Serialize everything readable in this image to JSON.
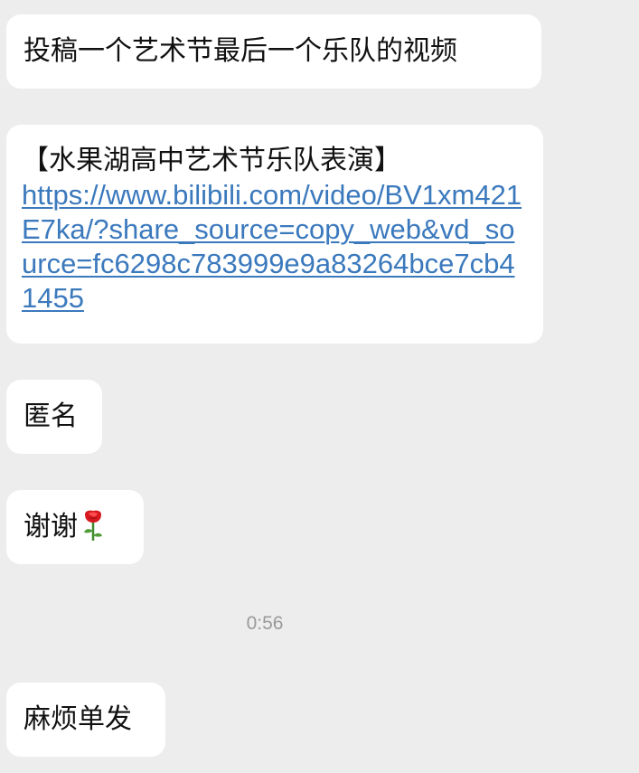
{
  "messages": [
    {
      "text": "投稿一个艺术节最后一个乐队的视频"
    },
    {
      "title": "【水果湖高中艺术节乐队表演】",
      "link": "https://www.bilibili.com/video/BV1xm421E7ka/?share_source=copy_web&vd_source=fc6298c783999e9a83264bce7cb41455"
    },
    {
      "text": "匿名"
    },
    {
      "text": "谢谢",
      "emoji": "rose-icon"
    },
    {
      "text": "麻烦单发"
    }
  ],
  "timestamp": "0:56",
  "colors": {
    "background": "#ededed",
    "bubble": "#ffffff",
    "link": "#3b79bd",
    "timestamp": "#9a9a9a"
  }
}
